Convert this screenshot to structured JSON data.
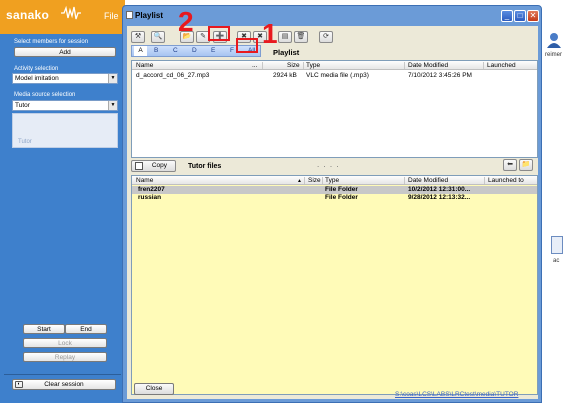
{
  "app": {
    "logo": "sanako",
    "menu_file": "File"
  },
  "left_panel": {
    "members_label": "Select members for session",
    "add_button": "Add",
    "activity_label": "Activity selection",
    "activity_value": "Model imitation",
    "media_label": "Media source selection",
    "media_value": "Tutor",
    "source_item": "Tutor",
    "start": "Start",
    "end": "End",
    "lock": "Lock",
    "replay": "Replay",
    "clear_session": "Clear session"
  },
  "window": {
    "title": "Playlist",
    "alpha_tabs": [
      "A",
      "B",
      "C",
      "D",
      "E",
      "F",
      "All"
    ],
    "playlist_label": "Playlist",
    "top_grid": {
      "columns": [
        "Name",
        "...",
        "Size",
        "Type",
        "Date Modified",
        "Launched"
      ],
      "rows": [
        {
          "name": "d_accord_cd_06_27.mp3",
          "size": "2924 kB",
          "type": "VLC media file (.mp3)",
          "modified": "7/10/2012 3:45:26 PM",
          "launched": ""
        }
      ]
    },
    "copy_button": "Copy",
    "tutor_files_label": "Tutor files",
    "dots": ". . . .",
    "bottom_grid": {
      "columns": [
        "Name",
        "Size",
        "Type",
        "Date Modified",
        "Launched to"
      ],
      "rows": [
        {
          "name": "fren2207",
          "size": "",
          "type": "File Folder",
          "modified": "10/2/2012 12:31:00...",
          "launched": ""
        },
        {
          "name": "russian",
          "size": "",
          "type": "File Folder",
          "modified": "9/28/2012 12:13:32...",
          "launched": ""
        }
      ]
    },
    "close_button": "Close",
    "status_path": "S:\\coas\\LCS\\LABS\\LRCtest\\media\\TUTOR"
  },
  "desktop": {
    "icon_label": "ac",
    "icon_label_2": "reimer"
  },
  "annotations": {
    "one": "1",
    "two": "2"
  },
  "colors": {
    "accent_orange": "#f0a020",
    "panel_blue": "#3e80cc",
    "window_blue": "#6b9bd7",
    "folder_highlight": "#fffbb8",
    "annotation_red": "#e8191e"
  }
}
